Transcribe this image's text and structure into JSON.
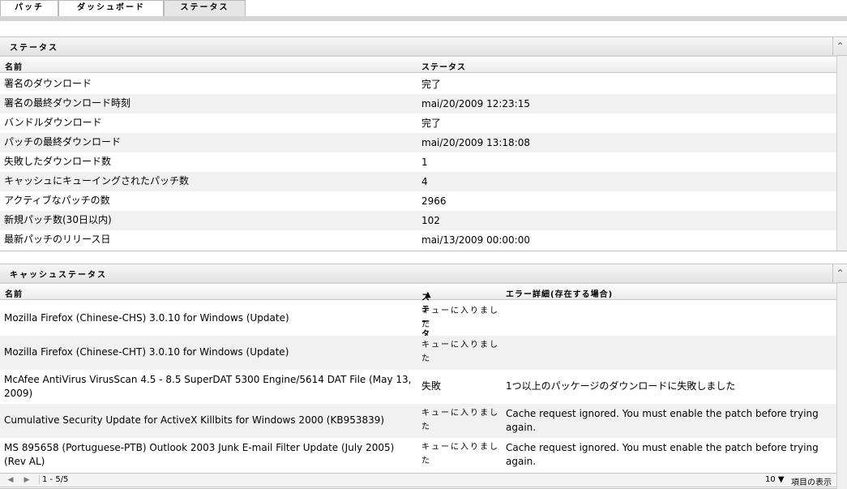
{
  "tabs": [
    {
      "label": "パッチ",
      "active": false
    },
    {
      "label": "ダッシュボード",
      "active": false
    },
    {
      "label": "ステータス",
      "active": true
    }
  ],
  "status_section": {
    "title": "ステータス",
    "columns": [
      "名前",
      "ステータス"
    ],
    "rows": [
      {
        "name": "署名のダウンロード",
        "status": "完了"
      },
      {
        "name": "署名の最終ダウンロード時刻",
        "status": "mai/20/2009 12:23:15"
      },
      {
        "name": "バンドルダウンロード",
        "status": "完了"
      },
      {
        "name": "パッチの最終ダウンロード",
        "status": "mai/20/2009 13:18:08"
      },
      {
        "name": "失敗したダウンロード数",
        "status": "1"
      },
      {
        "name": "キャッシュにキューイングされたパッチ数",
        "status": "4"
      },
      {
        "name": "アクティブなパッチの数",
        "status": "2966"
      },
      {
        "name": "新規パッチ数(30日以内)",
        "status": "102"
      },
      {
        "name": "最新パッチのリリース日",
        "status": "mai/13/2009 00:00:00"
      }
    ]
  },
  "cache_section": {
    "title": "キャッシュステータス",
    "columns": [
      "名前",
      "ステータス",
      "エラー詳細(存在する場合)"
    ],
    "sort_icon": "sort-asc-icon",
    "rows": [
      {
        "name": "Mozilla Firefox (Chinese-CHS) 3.0.10 for Windows (Update)",
        "status": "キューに入りました",
        "error": ""
      },
      {
        "name": "Mozilla Firefox (Chinese-CHT) 3.0.10 for Windows (Update)",
        "status": "キューに入りました",
        "error": ""
      },
      {
        "name": "McAfee AntiVirus VirusScan 4.5 - 8.5 SuperDAT 5300 Engine/5614 DAT File (May 13, 2009)",
        "status": "失敗",
        "error": "1つ以上のパッケージのダウンロードに失敗しました"
      },
      {
        "name": "Cumulative Security Update for ActiveX Killbits for Windows 2000 (KB953839)",
        "status": "キューに入りました",
        "error": "Cache request ignored. You must enable the patch before trying again."
      },
      {
        "name": "MS 895658 (Portuguese-PTB) Outlook 2003 Junk E-mail Filter Update (July 2005) (Rev AL)",
        "status": "キューに入りました",
        "error": "Cache request ignored. You must enable the patch before trying again."
      }
    ],
    "footer": {
      "range": "1 - 5/5",
      "page_size": "10",
      "page_size_label": "項目の表示"
    }
  }
}
